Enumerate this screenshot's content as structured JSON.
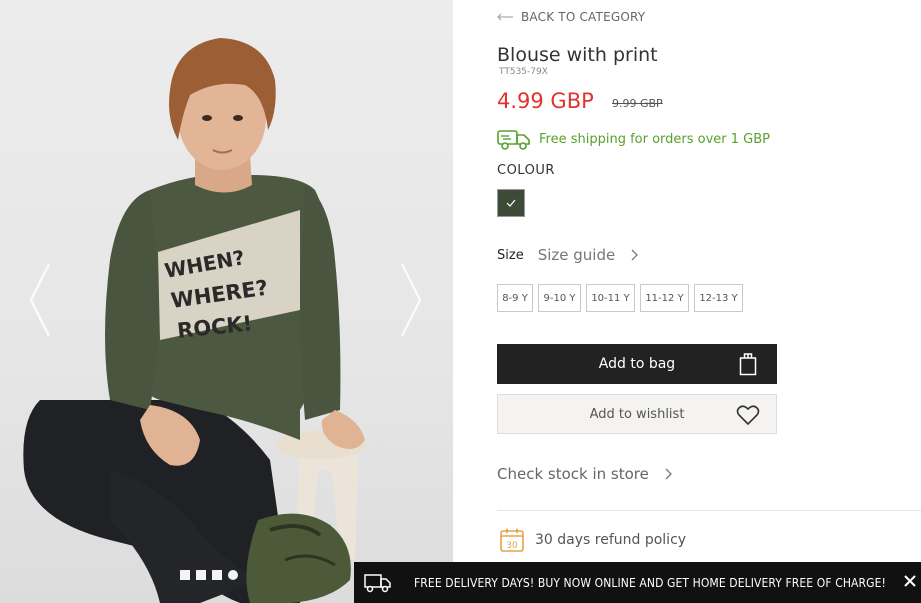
{
  "product": {
    "back_label": "BACK TO CATEGORY",
    "title": "Blouse with print",
    "sku": "TT535-79X",
    "price": "4.99 GBP",
    "old_price": "9.99 GBP",
    "shipping": "Free shipping for orders over 1 GBP",
    "colour_label": "COLOUR",
    "colour_swatch": "#3e4a38",
    "size_label": "Size",
    "size_guide": "Size guide",
    "sizes": [
      "8-9 Y",
      "9-10 Y",
      "10-11 Y",
      "11-12 Y",
      "12-13 Y"
    ],
    "add_to_bag": "Add to bag",
    "add_to_wishlist": "Add to wishlist",
    "check_stock": "Check stock in store",
    "refund": "30 days refund policy",
    "refund_icon_number": "30"
  },
  "gallery": {
    "shirt_print": [
      "WHEN?",
      "WHERE?",
      "ROCK!"
    ],
    "slides": 4,
    "active_slide": 4
  },
  "promo": {
    "text": "FREE DELIVERY DAYS! BUY NOW ONLINE AND GET HOME DELIVERY FREE OF CHARGE!"
  },
  "colors": {
    "accent_price": "#e1322c",
    "shipping_green": "#5aa02c",
    "refund_orange": "#e8a04a",
    "button_dark": "#222222"
  }
}
